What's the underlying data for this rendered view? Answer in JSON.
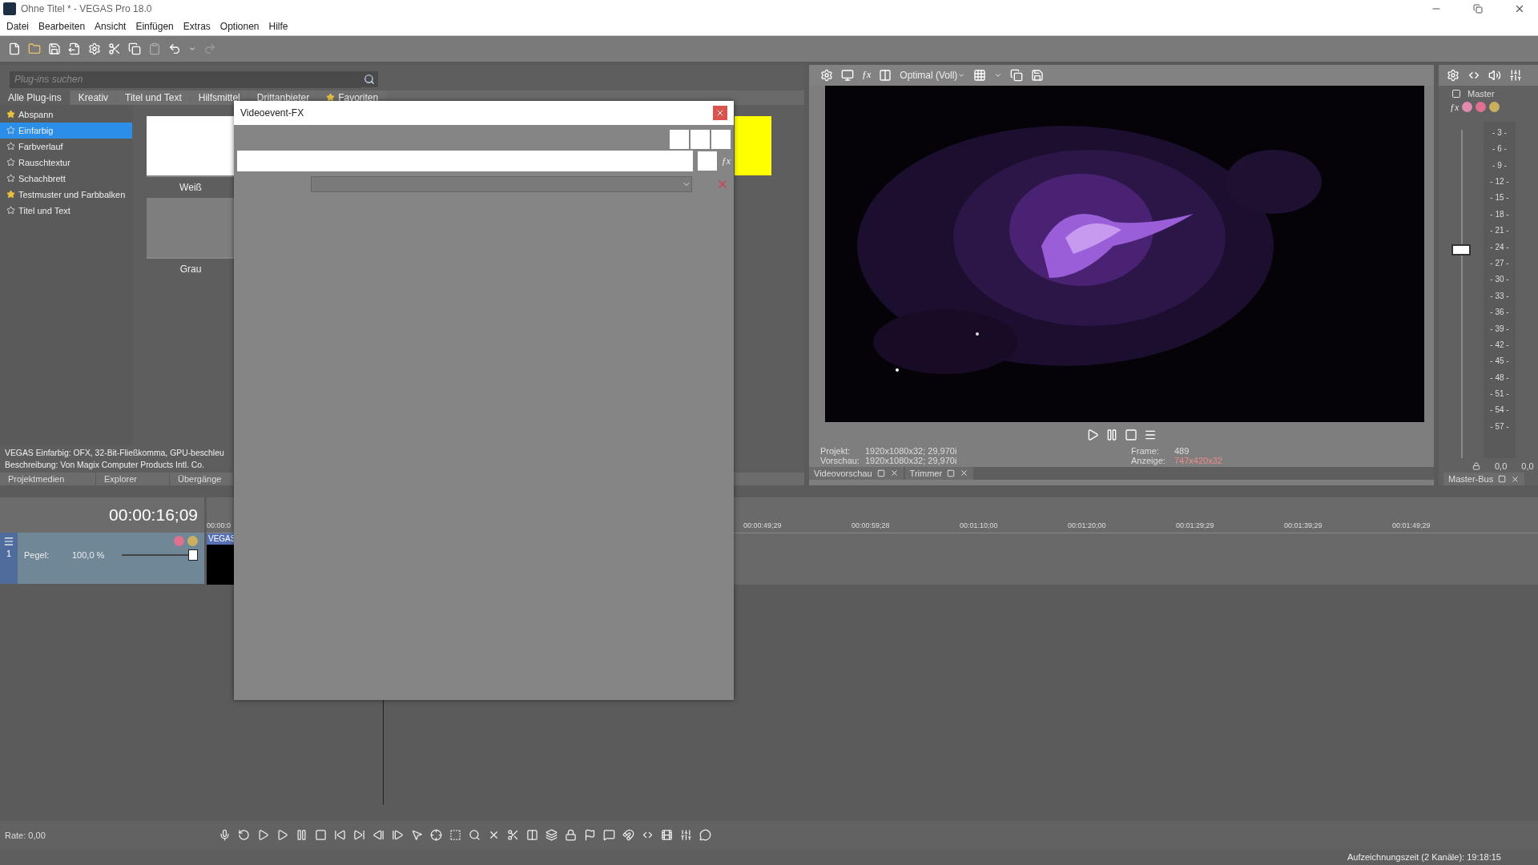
{
  "window": {
    "title": "Ohne Titel * - VEGAS Pro 18.0"
  },
  "menu": [
    "Datei",
    "Bearbeiten",
    "Ansicht",
    "Einfügen",
    "Extras",
    "Optionen",
    "Hilfe"
  ],
  "plugin_browser": {
    "search": {
      "placeholder": "Plug-ins suchen"
    },
    "tabs": [
      {
        "label": "Alle Plug-ins",
        "selected": true
      },
      {
        "label": "Kreativ",
        "selected": false
      },
      {
        "label": "Titel und Text",
        "selected": false
      },
      {
        "label": "Hilfsmittel",
        "selected": false
      },
      {
        "label": "Drittanbieter",
        "selected": false
      },
      {
        "label": "Favoriten",
        "selected": false
      }
    ],
    "items": [
      {
        "label": "Abspann",
        "favorite": true,
        "selected": false
      },
      {
        "label": "Einfarbig",
        "favorite": false,
        "selected": true
      },
      {
        "label": "Farbverlauf",
        "favorite": false,
        "selected": false
      },
      {
        "label": "Rauschtextur",
        "favorite": false,
        "selected": false
      },
      {
        "label": "Schachbrett",
        "favorite": false,
        "selected": false
      },
      {
        "label": "Testmuster und Farbbalken",
        "favorite": true,
        "selected": false
      },
      {
        "label": "Titel und Text",
        "favorite": false,
        "selected": false
      }
    ],
    "thumbnails": [
      {
        "label": "Weiß",
        "color": "#ffffff"
      },
      {
        "label": "Grau",
        "color": "#7e7e7e"
      }
    ],
    "clipped_thumbnail": {
      "color": "#ffff00"
    },
    "info": [
      "VEGAS Einfarbig: OFX, 32-Bit-Fließkomma, GPU-beschleu",
      "Beschreibung: Von Magix Computer Products Intl. Co."
    ],
    "dock_tabs": [
      "Projektmedien",
      "Explorer",
      "Übergänge"
    ]
  },
  "preview": {
    "fx_button": "ƒx",
    "quality": "Optimal (Voll)",
    "info": [
      {
        "label": "Projekt:",
        "value": "1920x1080x32; 29,970i"
      },
      {
        "label": "Vorschau:",
        "value": "1920x1080x32; 29,970i"
      }
    ],
    "frame": {
      "label": "Frame:",
      "value": "489"
    },
    "display": {
      "label": "Anzeige:",
      "value": "747x420x32"
    },
    "tabs": [
      "Videovorschau",
      "Trimmer"
    ]
  },
  "master": {
    "title": "Master",
    "fx_button": "ƒx",
    "level": 0.65,
    "scale": [
      "- 3 -",
      "- 6 -",
      "- 9 -",
      "- 12 -",
      "- 15 -",
      "- 18 -",
      "- 21 -",
      "- 24 -",
      "- 27 -",
      "- 30 -",
      "- 33 -",
      "- 36 -",
      "- 39 -",
      "- 42 -",
      "- 45 -",
      "- 48 -",
      "- 51 -",
      "- 54 -",
      "- 57 -"
    ],
    "readings": [
      "0,0",
      "0,0"
    ],
    "tab": "Master-Bus"
  },
  "timeline": {
    "time": "00:00:16;09",
    "track": {
      "number": "1",
      "level_label": "Pegel:",
      "level_value": "100,0 %",
      "level": 1.0
    },
    "clip_label": "VEGAS",
    "ruler_clipped": "00:00:0",
    "ruler": [
      "00:00:49;29",
      "00:00:59;28",
      "00:01:10;00",
      "00:01:20;00",
      "00:01:29;29",
      "00:01:39;29",
      "00:01:49;29"
    ]
  },
  "transport": {
    "rate": "Rate: 0,00"
  },
  "status": "Aufzeichnungszeit (2 Kanäle): 19:18:15",
  "dialog": {
    "title": "Videoevent-FX",
    "fx_button": "ƒx"
  }
}
